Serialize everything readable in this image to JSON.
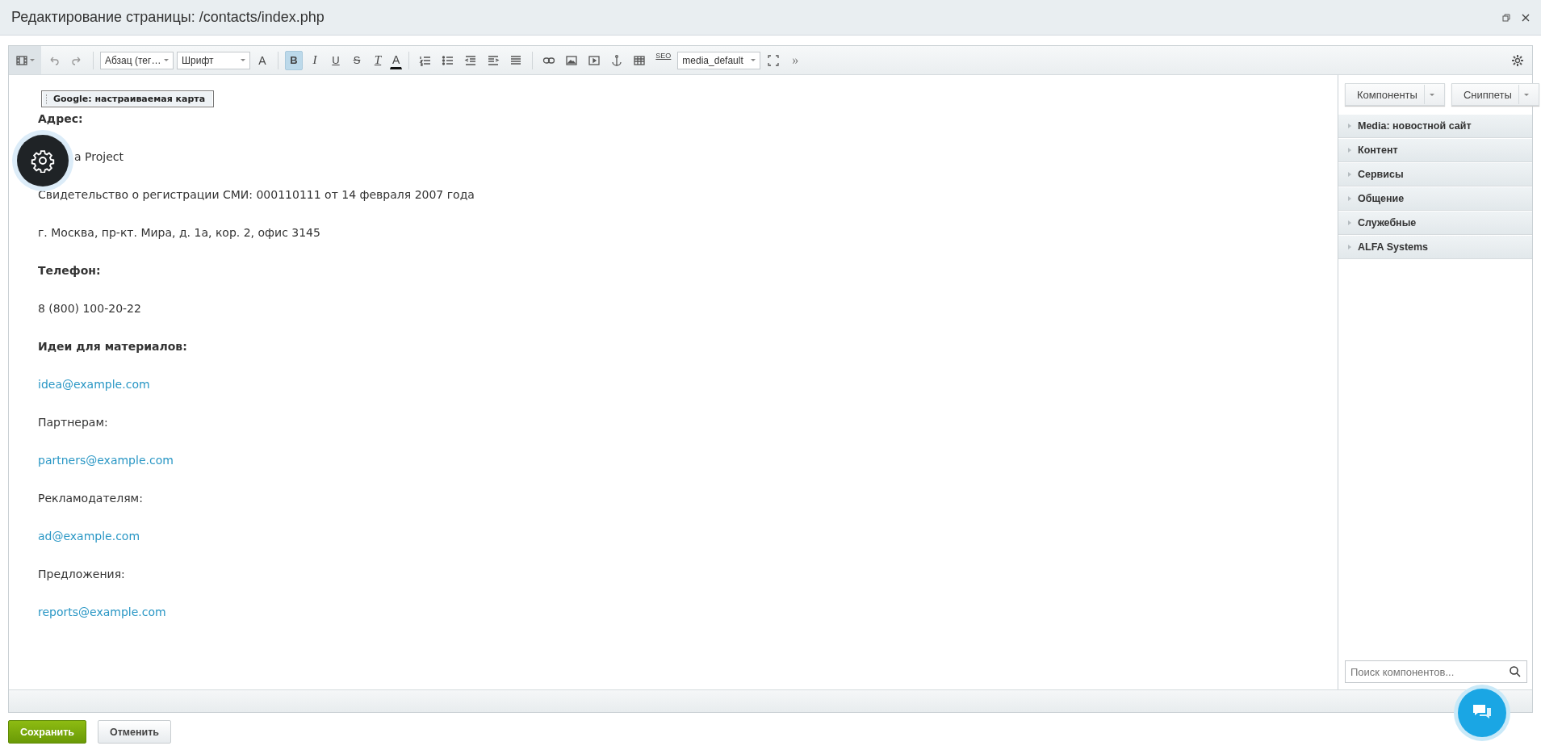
{
  "window": {
    "title": "Редактирование страницы: /contacts/index.php"
  },
  "toolbar": {
    "tools": [
      {
        "kind": "view",
        "on": false
      },
      {
        "kind": "undo",
        "on": false
      },
      {
        "kind": "redo",
        "on": false
      },
      {
        "kind": "select",
        "value": "Абзац (тег…",
        "on": false
      },
      {
        "kind": "select",
        "value": "Шрифт",
        "on": false
      },
      {
        "kind": "size",
        "label": "A",
        "on": false
      },
      {
        "kind": "bold",
        "label": "B",
        "on": true
      },
      {
        "kind": "italic",
        "label": "I",
        "on": false
      },
      {
        "kind": "underline",
        "label": "U",
        "on": false
      },
      {
        "kind": "strike",
        "label": "S",
        "on": false
      },
      {
        "kind": "clear",
        "label": "T",
        "on": false
      },
      {
        "kind": "color",
        "label": "A",
        "on": false
      },
      {
        "kind": "olist",
        "on": false
      },
      {
        "kind": "ulist",
        "on": false
      },
      {
        "kind": "outdent",
        "on": false
      },
      {
        "kind": "indent",
        "on": false
      },
      {
        "kind": "justify",
        "on": false
      },
      {
        "kind": "link",
        "on": false
      },
      {
        "kind": "image",
        "on": false
      },
      {
        "kind": "video",
        "on": false
      },
      {
        "kind": "anchor",
        "on": false
      },
      {
        "kind": "table",
        "on": false
      },
      {
        "kind": "seo",
        "label": "SEO",
        "on": false
      },
      {
        "kind": "select",
        "value": "media_default",
        "on": false
      },
      {
        "kind": "fullscreen",
        "on": false
      },
      {
        "kind": "more",
        "label": "»",
        "on": false
      }
    ]
  },
  "editor": {
    "component_tag": "Google: настраиваемая карта",
    "paragraphs": [
      {
        "kind": "heading",
        "text": "Адрес:"
      },
      {
        "kind": "covered",
        "text": "a Project"
      },
      {
        "kind": "text",
        "text": "Свидетельство о регистрации СМИ: 000110111 от 14 февраля 2007 года"
      },
      {
        "kind": "text",
        "text": "г. Москва, пр-кт. Мира, д. 1а, кор. 2, офис 3145"
      },
      {
        "kind": "heading",
        "text": "Телефон:"
      },
      {
        "kind": "text",
        "text": "8 (800) 100-20-22"
      },
      {
        "kind": "heading",
        "text": "Идеи для материалов:"
      },
      {
        "kind": "link",
        "text": "idea@example.com"
      },
      {
        "kind": "text",
        "text": "Партнерам:"
      },
      {
        "kind": "link",
        "text": "partners@example.com"
      },
      {
        "kind": "text",
        "text": "Рекламодателям:"
      },
      {
        "kind": "link",
        "text": "ad@example.com"
      },
      {
        "kind": "text",
        "text": "Предложения:"
      },
      {
        "kind": "link",
        "text": "reports@example.com"
      }
    ]
  },
  "sidebar": {
    "tabs": [
      "Компоненты",
      "Сниппеты"
    ],
    "groups": [
      {
        "label": "Media: новостной сайт",
        "expanded": false
      },
      {
        "label": "Контент",
        "expanded": false
      },
      {
        "label": "Сервисы",
        "expanded": false
      },
      {
        "label": "Общение",
        "expanded": false
      },
      {
        "label": "Служебные",
        "expanded": false
      },
      {
        "label": "ALFA Systems",
        "expanded": false
      }
    ],
    "search": {
      "placeholder": "Поиск компонентов..."
    }
  },
  "buttons": [
    {
      "kind": "primary",
      "label": "Сохранить"
    },
    {
      "kind": "secondary",
      "label": "Отменить"
    }
  ]
}
